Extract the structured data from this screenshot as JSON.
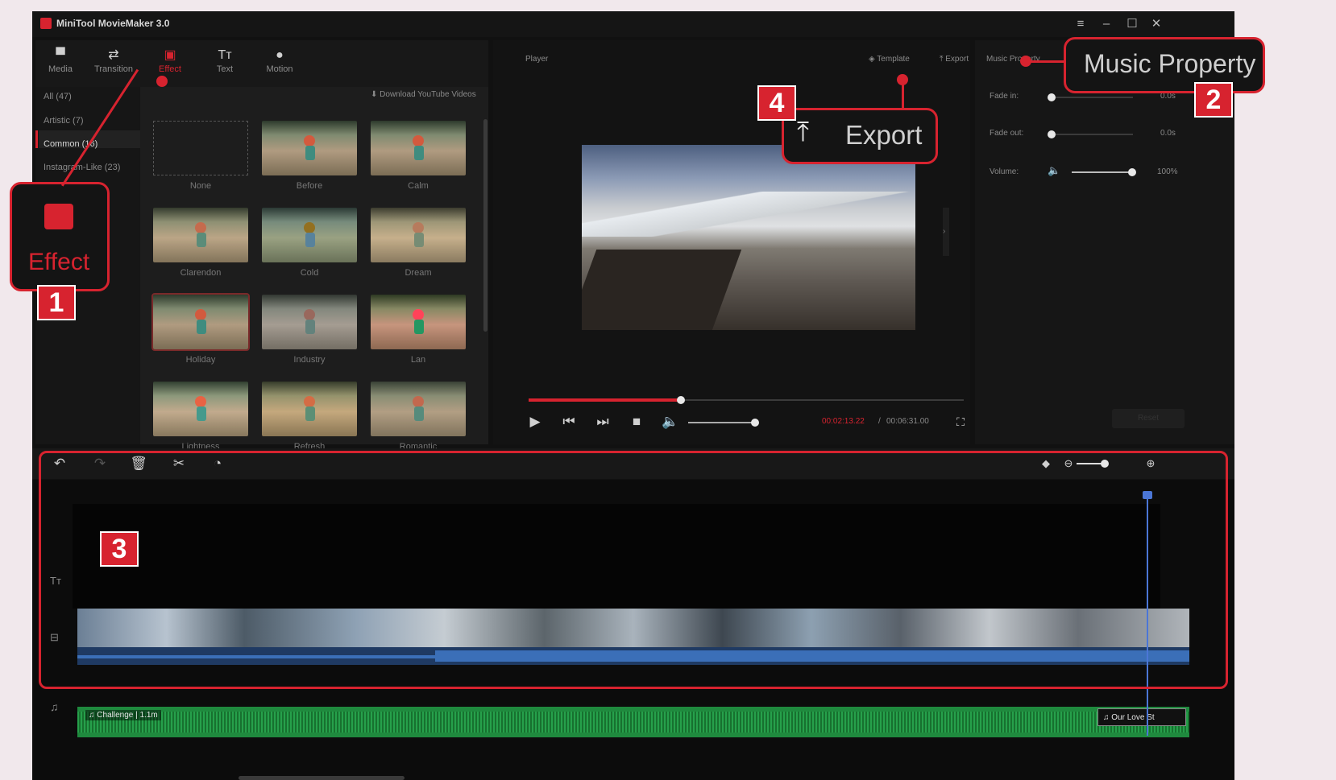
{
  "app": {
    "title": "MiniTool MovieMaker 3.0"
  },
  "tabs": [
    {
      "label": "Media",
      "icon": "folder-icon"
    },
    {
      "label": "Transition",
      "icon": "swap-icon"
    },
    {
      "label": "Effect",
      "icon": "effect-icon"
    },
    {
      "label": "Text",
      "icon": "text-icon"
    },
    {
      "label": "Motion",
      "icon": "motion-icon"
    }
  ],
  "categories": [
    "All (47)",
    "Artistic (7)",
    "Common (16)",
    "Instagram-Like (23)"
  ],
  "download_link": "Download YouTube Videos",
  "effects": [
    "None",
    "Before",
    "Calm",
    "Clarendon",
    "Cold",
    "Dream",
    "Holiday",
    "Industry",
    "Lan",
    "Lightness",
    "Refresh",
    "Romantic"
  ],
  "player": {
    "label": "Player",
    "template": "Template",
    "export": "Export",
    "time_current": "00:02:13.22",
    "time_total": "00:06:31.00",
    "progress": 0.35,
    "volume": 1.0
  },
  "music_property": {
    "label": "Music Property",
    "fade_in_label": "Fade in:",
    "fade_in_value": "0.0s",
    "fade_out_label": "Fade out:",
    "fade_out_value": "0.0s",
    "volume_label": "Volume:",
    "volume_value": "100%",
    "reset_label": "Reset"
  },
  "audio_clips": [
    {
      "name": "Challenge",
      "duration": "1.1m"
    },
    {
      "name": "Our Love St"
    }
  ],
  "callouts": {
    "effect_label": "Effect",
    "export_label": "Export",
    "music_label": "Music Property",
    "n1": "1",
    "n2": "2",
    "n3": "3",
    "n4": "4"
  },
  "colors": {
    "accent": "#d7232f",
    "audio_track": "#1f8a3e",
    "waveform": "#3b6fb8"
  }
}
